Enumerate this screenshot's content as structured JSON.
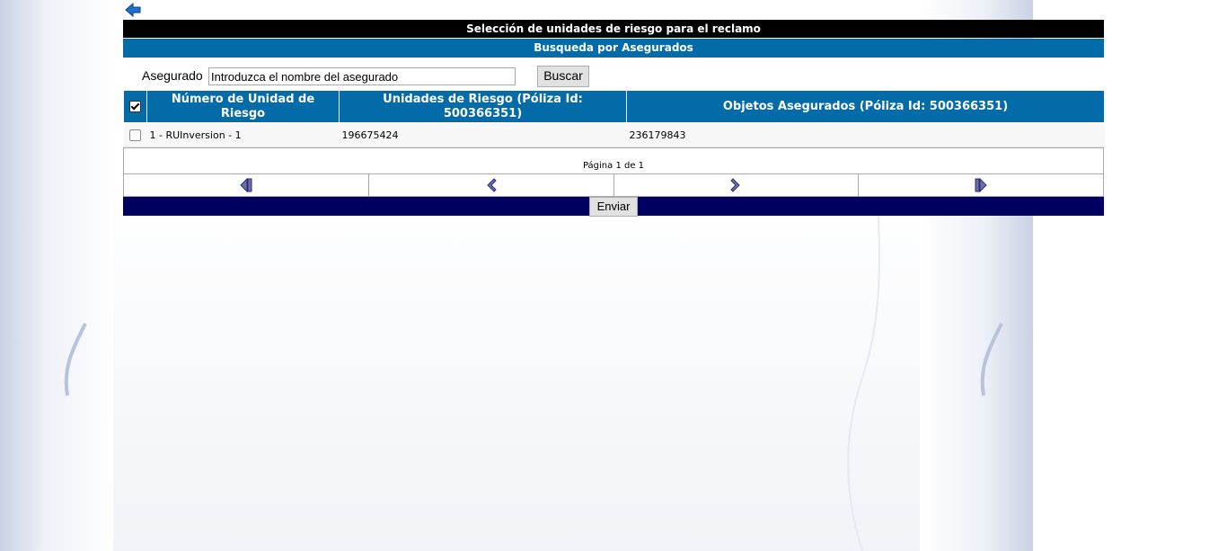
{
  "header": {
    "title": "Selección de unidades de riesgo para el reclamo",
    "subtitle": "Busqueda por Asegurados"
  },
  "search": {
    "label": "Asegurado",
    "value": "Introduzca el nombre del asegurado",
    "button": "Buscar"
  },
  "table": {
    "columns": [
      "Número de Unidad de Riesgo",
      "Unidades de Riesgo (Póliza Id: 500366351)",
      "Objetos Asegurados (Póliza Id: 500366351)"
    ],
    "rows": [
      [
        "1 - RUInversion - 1",
        "196675424",
        "236179843"
      ]
    ]
  },
  "pager": {
    "info": "Página 1 de 1"
  },
  "footer": {
    "send": "Enviar"
  },
  "colors": {
    "title_bg": "#000000",
    "header_bg": "#036ba8",
    "footer_bg": "#000060"
  }
}
